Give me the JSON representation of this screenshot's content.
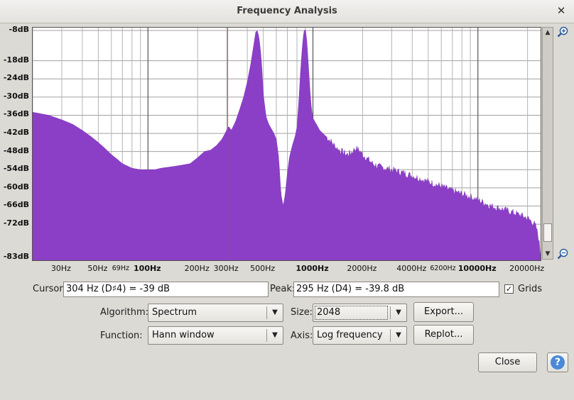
{
  "window": {
    "title": "Frequency Analysis",
    "close_glyph": "✕"
  },
  "chart_data": {
    "type": "area",
    "xscale": "log",
    "xlim": [
      20,
      24000
    ],
    "ylim": [
      -83,
      -8
    ],
    "grid": true,
    "color": "#8b3fc7",
    "y_ticks": [
      "-8dB",
      "-18dB",
      "-24dB",
      "-30dB",
      "-36dB",
      "-42dB",
      "-48dB",
      "-54dB",
      "-60dB",
      "-66dB",
      "-72dB",
      "-83dB"
    ],
    "x_ticks": [
      "30Hz",
      "50Hz",
      "69Hz",
      "100Hz",
      "200Hz",
      "300Hz",
      "500Hz",
      "1000Hz",
      "2000Hz",
      "4000Hz",
      "6200Hz",
      "10000Hz",
      "20000Hz"
    ],
    "cursor_hz": 304,
    "spectrum": {
      "x": [
        20,
        25,
        30,
        35,
        40,
        45,
        50,
        55,
        60,
        65,
        70,
        80,
        90,
        100,
        110,
        120,
        140,
        160,
        180,
        200,
        220,
        240,
        260,
        280,
        290,
        300,
        305,
        310,
        320,
        340,
        360,
        380,
        400,
        420,
        440,
        450,
        460,
        470,
        480,
        490,
        500,
        520,
        540,
        560,
        580,
        600,
        620,
        640,
        660,
        680,
        700,
        720,
        750,
        780,
        800,
        820,
        840,
        860,
        880,
        900,
        920,
        940,
        960,
        980,
        1000,
        1050,
        1100,
        1150,
        1200,
        1300,
        1400,
        1500,
        1600,
        1700,
        1800,
        1900,
        2000,
        2100,
        2200,
        2300,
        2500,
        3000,
        3500,
        4000,
        5000,
        6000,
        7000,
        8000,
        9000,
        10000,
        11000,
        12000,
        13000,
        14000,
        15000,
        16000,
        17000,
        18000,
        19000,
        20000,
        21000,
        22000,
        22500,
        23000,
        23500,
        24000
      ],
      "y": [
        -35,
        -36,
        -37.5,
        -39,
        -41,
        -43,
        -45,
        -47,
        -49,
        -50.5,
        -52,
        -53.5,
        -54,
        -54,
        -54,
        -53.5,
        -53,
        -52.5,
        -52,
        -50,
        -48,
        -47.5,
        -46,
        -44,
        -42.5,
        -41,
        -40,
        -39.8,
        -41,
        -38,
        -34,
        -30,
        -25,
        -19,
        -12,
        -8.5,
        -8,
        -10,
        -14,
        -20,
        -29,
        -36.5,
        -39,
        -40.5,
        -42,
        -44,
        -50,
        -62,
        -66,
        -62,
        -55,
        -50,
        -46,
        -43,
        -40,
        -32,
        -22,
        -14,
        -8.5,
        -7.5,
        -12,
        -20,
        -28,
        -34,
        -37,
        -39,
        -41,
        -42,
        -43,
        -45,
        -47,
        -48,
        -49,
        -48.5,
        -47,
        -47.5,
        -49,
        -50,
        -51,
        -52,
        -53,
        -54,
        -55,
        -56,
        -58,
        -59.5,
        -61,
        -62,
        -63,
        -64,
        -65,
        -66,
        -66.5,
        -67,
        -67.5,
        -68,
        -68.5,
        -69,
        -69.5,
        -70,
        -71,
        -72,
        -73,
        -75,
        -78,
        -82
      ]
    }
  },
  "cursor": {
    "label": "Cursor:",
    "value": "304 Hz (D♯4) = -39 dB"
  },
  "peak": {
    "label": "Peak:",
    "value": "295 Hz (D4) = -39.8 dB"
  },
  "grids": {
    "label": "Grids",
    "check": "✓"
  },
  "algorithm": {
    "label": "Algorithm:",
    "value": "Spectrum"
  },
  "size": {
    "label": "Size:",
    "value": "2048"
  },
  "function": {
    "label": "Function:",
    "value": "Hann window"
  },
  "axis": {
    "label": "Axis:",
    "value": "Log frequency"
  },
  "buttons": {
    "export": "Export...",
    "replot": "Replot...",
    "close": "Close",
    "help": "?"
  },
  "glyphs": {
    "dropdown": "▼",
    "scroll_up": "▲",
    "scroll_down": "▼"
  }
}
